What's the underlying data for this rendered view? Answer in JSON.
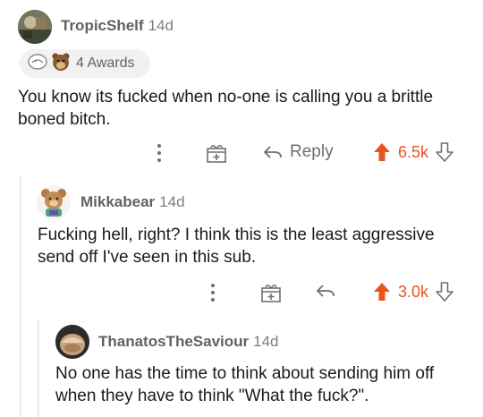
{
  "comments": [
    {
      "username": "TropicShelf",
      "age": "14d",
      "awards_label": "4 Awards",
      "body": "You know its fucked when no-one is calling you a brittle boned bitch.",
      "reply_label": "Reply",
      "score": "6.5k"
    },
    {
      "username": "Mikkabear",
      "age": "14d",
      "body": "Fucking hell, right? I think this is the least aggressive send off I've seen in this sub.",
      "score": "3.0k"
    },
    {
      "username": "ThanatosTheSaviour",
      "age": "14d",
      "body": "No one has the time to think about sending him off when they have to think \"What the fuck?\"."
    }
  ],
  "colors": {
    "upvote_accent": "#e8541e",
    "muted_text": "#6d6f71",
    "pill_bg": "#f1f1f2"
  },
  "icons": [
    "more-icon",
    "award-gift-icon",
    "reply-arrow-icon",
    "upvote-icon",
    "downvote-icon",
    "silver-award-icon",
    "bear-award-icon"
  ]
}
